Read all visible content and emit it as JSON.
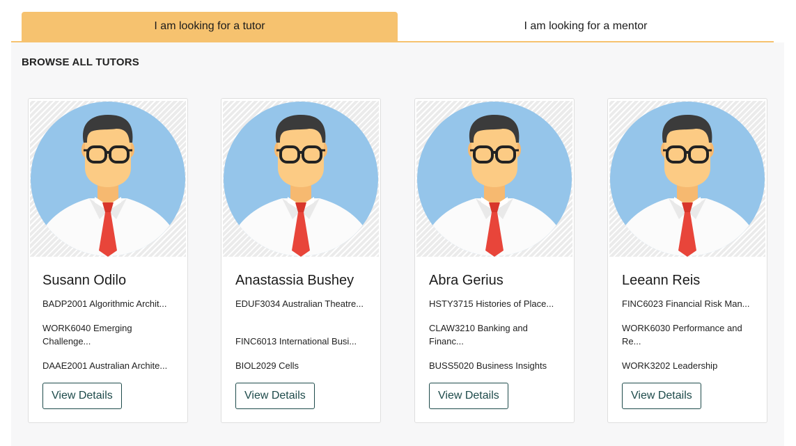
{
  "tabs": {
    "tutor_label": "I am looking for a tutor",
    "mentor_label": "I am looking for a mentor"
  },
  "section_title": "BROWSE ALL TUTORS",
  "button_label": "View Details",
  "avatar_icon": "male-avatar-with-glasses-and-red-tie",
  "colors": {
    "accent": "#f6c26f",
    "button": "#1d4a4a"
  },
  "tutors": [
    {
      "name": "Susann Odilo",
      "courses": [
        "BADP2001 Algorithmic Archit...",
        "WORK6040 Emerging Challenge...",
        "DAAE2001 Australian Archite..."
      ]
    },
    {
      "name": "Anastassia Bushey",
      "courses": [
        "EDUF3034 Australian Theatre...",
        "FINC6013 International Busi...",
        "BIOL2029 Cells"
      ]
    },
    {
      "name": "Abra Gerius",
      "courses": [
        "HSTY3715 Histories of Place...",
        "CLAW3210 Banking and Financ...",
        "BUSS5020 Business Insights"
      ]
    },
    {
      "name": "Leeann Reis",
      "courses": [
        "FINC6023 Financial Risk Man...",
        "WORK6030 Performance and Re...",
        "WORK3202 Leadership"
      ]
    }
  ]
}
